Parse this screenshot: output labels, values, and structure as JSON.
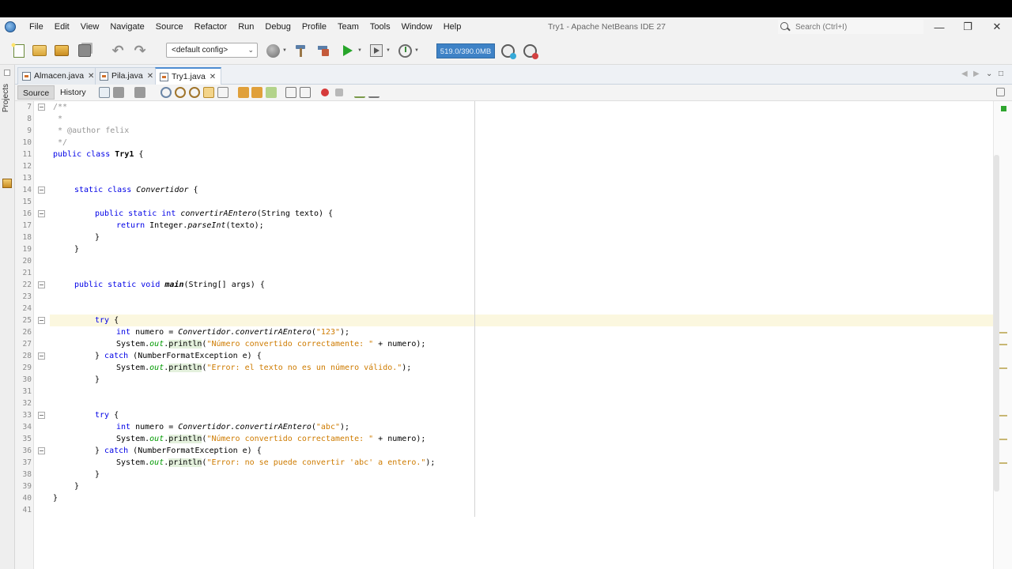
{
  "menubar": {
    "items": [
      "File",
      "Edit",
      "View",
      "Navigate",
      "Source",
      "Refactor",
      "Run",
      "Debug",
      "Profile",
      "Team",
      "Tools",
      "Window",
      "Help"
    ],
    "window_title": "Try1 - Apache NetBeans IDE 27",
    "search_placeholder": "Search (Ctrl+I)"
  },
  "toolbar": {
    "config": "<default config>",
    "memory": "519.0/390.0MB"
  },
  "sidebar": {
    "projects_label": "Projects"
  },
  "tabs": [
    {
      "label": "Almacen.java",
      "active": false
    },
    {
      "label": "Pila.java",
      "active": false
    },
    {
      "label": "Try1.java",
      "active": true
    }
  ],
  "editor_toolbar": {
    "source_label": "Source",
    "history_label": "History"
  },
  "editor": {
    "highlighted_line": 25,
    "lines": [
      {
        "n": "7"
      },
      {
        "n": "8"
      },
      {
        "n": "9"
      },
      {
        "n": "10"
      },
      {
        "n": "11"
      },
      {
        "n": "12"
      },
      {
        "n": "13"
      },
      {
        "n": "14"
      },
      {
        "n": "15"
      },
      {
        "n": "16"
      },
      {
        "n": "17"
      },
      {
        "n": "18"
      },
      {
        "n": "19"
      },
      {
        "n": "20"
      },
      {
        "n": "21"
      },
      {
        "n": "22"
      },
      {
        "n": "23"
      },
      {
        "n": "24"
      },
      {
        "n": "25"
      },
      {
        "n": "26"
      },
      {
        "n": "27"
      },
      {
        "n": "28"
      },
      {
        "n": "29"
      },
      {
        "n": "30"
      },
      {
        "n": "31"
      },
      {
        "n": "32"
      },
      {
        "n": "33"
      },
      {
        "n": "34"
      },
      {
        "n": "35"
      },
      {
        "n": "36"
      },
      {
        "n": "37"
      },
      {
        "n": "38"
      },
      {
        "n": "39"
      },
      {
        "n": "40"
      },
      {
        "n": "41"
      }
    ],
    "code": {
      "l7": "/**",
      "l8": " *",
      "l9": " * @author felix",
      "l10": " */",
      "l11_kw": "public class ",
      "l11_name": "Try1",
      "l11_rest": " {",
      "l14_kw": "static class ",
      "l14_name": "Convertidor",
      "l14_rest": " {",
      "l16_kw": "public static int ",
      "l16_name": "convertirAEntero",
      "l16_rest": "(String texto) {",
      "l17_kw": "return ",
      "l17_a": "Integer.",
      "l17_m": "parseInt",
      "l17_b": "(texto);",
      "l18": "}",
      "l19": "}",
      "l22_kw": "public static void ",
      "l22_name": "main",
      "l22_rest": "(String[] args) {",
      "l25_kw": "try",
      "l25_rest": " {",
      "l26_kw": "int",
      "l26_a": " numero = ",
      "l26_cls": "Convertidor.",
      "l26_m": "convertirAEntero",
      "l26_b": "(",
      "l26_s": "\"123\"",
      "l26_c": ");",
      "l27_a": "System.",
      "l27_out": "out",
      "l27_b": ".",
      "l27_m": "println",
      "l27_c": "(",
      "l27_s": "\"Número convertido correctamente: \"",
      "l27_d": " + numero);",
      "l28_a": "} ",
      "l28_kw": "catch",
      "l28_b": " (NumberFormatException e) {",
      "l29_a": "System.",
      "l29_out": "out",
      "l29_b": ".",
      "l29_m": "println",
      "l29_c": "(",
      "l29_s": "\"Error: el texto no es un número válido.\"",
      "l29_d": ");",
      "l30": "}",
      "l33_kw": "try",
      "l33_rest": " {",
      "l34_kw": "int",
      "l34_a": " numero = ",
      "l34_cls": "Convertidor.",
      "l34_m": "convertirAEntero",
      "l34_b": "(",
      "l34_s": "\"abc\"",
      "l34_c": ");",
      "l35_a": "System.",
      "l35_out": "out",
      "l35_b": ".",
      "l35_m": "println",
      "l35_c": "(",
      "l35_s": "\"Número convertido correctamente: \"",
      "l35_d": " + numero);",
      "l36_a": "} ",
      "l36_kw": "catch",
      "l36_b": " (NumberFormatException e) {",
      "l37_a": "System.",
      "l37_out": "out",
      "l37_b": ".",
      "l37_m": "println",
      "l37_c": "(",
      "l37_s": "\"Error: no se puede convertir 'abc' a entero.\"",
      "l37_d": ");",
      "l38": "}",
      "l39": "}",
      "l40": "}"
    }
  },
  "colors": {
    "keyword": "#0000e6",
    "comment": "#969696",
    "string": "#ce7b00",
    "field": "#009900",
    "memory_bar": "#3e82c6"
  }
}
